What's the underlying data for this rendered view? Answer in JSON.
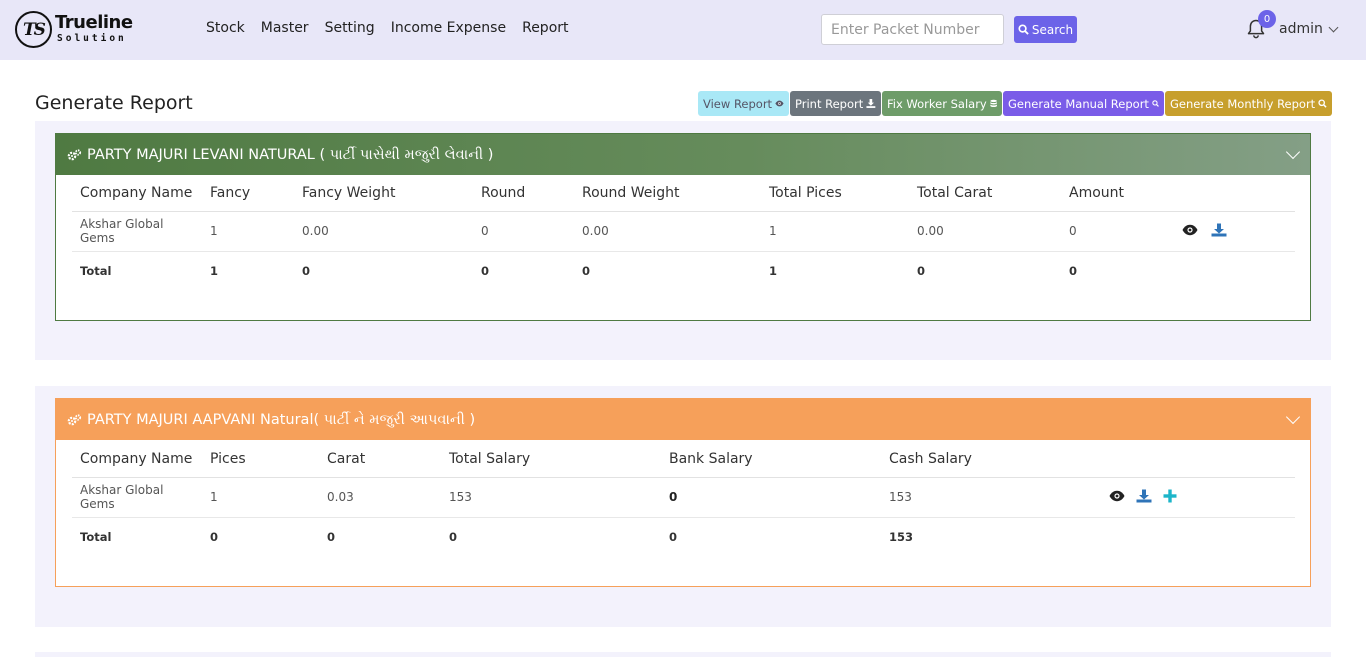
{
  "brand": {
    "mark": "TS",
    "name": "Trueline",
    "sub": "Solution"
  },
  "nav": {
    "items": [
      "Stock",
      "Master",
      "Setting",
      "Income Expense",
      "Report"
    ]
  },
  "search": {
    "placeholder": "Enter Packet Number",
    "button_label": "Search"
  },
  "notifications": {
    "count": "0"
  },
  "user": {
    "name": "admin"
  },
  "page": {
    "title": "Generate Report",
    "buttons": {
      "view": "View Report",
      "print": "Print Report",
      "fix_salary": "Fix Worker Salary",
      "manual": "Generate Manual Report",
      "monthly": "Generate Monthly Report"
    }
  },
  "section1": {
    "title": "PARTY MAJURI LEVANI NATURAL ( પાર્ટી પાસેથી મજુરી લેવાની )",
    "color": "#4f7a42",
    "columns": [
      "Company Name",
      "Fancy",
      "Fancy Weight",
      "Round",
      "Round Weight",
      "Total Pices",
      "Total Carat",
      "Amount",
      ""
    ],
    "rows": [
      [
        "Akshar Global Gems",
        "1",
        "0.00",
        "0",
        "0.00",
        "1",
        "0.00",
        "0"
      ]
    ],
    "total": [
      "Total",
      "1",
      "0",
      "0",
      "0",
      "1",
      "0",
      "0"
    ]
  },
  "section2": {
    "title": "PARTY MAJURI AAPVANI Natural( પાર્ટી ને મજુરી આપવાની )",
    "color": "#f6a05a",
    "columns": [
      "Company Name",
      "Pices",
      "Carat",
      "Total Salary",
      "Bank Salary",
      "Cash Salary",
      ""
    ],
    "rows": [
      [
        "Akshar Global Gems",
        "1",
        "0.03",
        "153",
        "0",
        "153"
      ]
    ],
    "total": [
      "Total",
      "0",
      "0",
      "0",
      "0",
      "153"
    ]
  }
}
